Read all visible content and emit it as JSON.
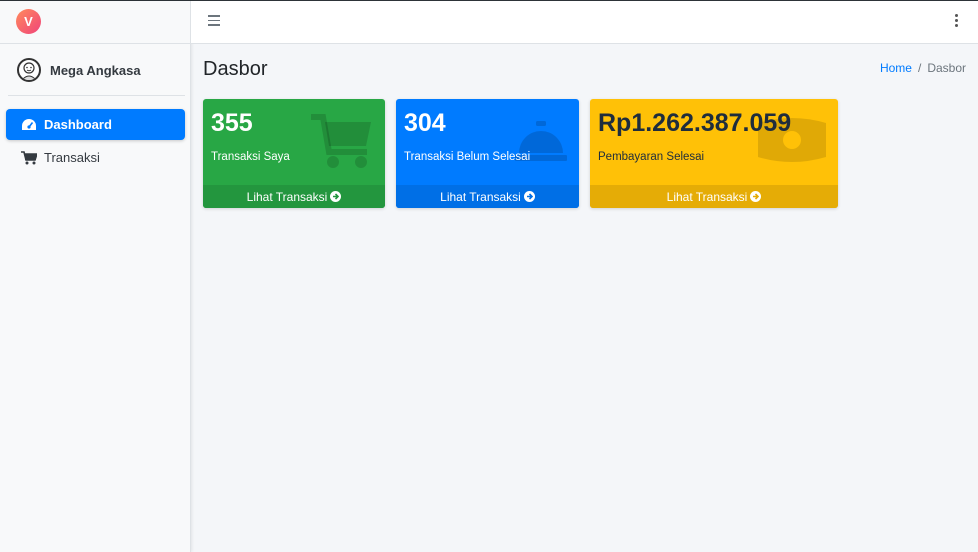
{
  "brand": {
    "logo_letter": "V"
  },
  "user": {
    "name": "Mega Angkasa"
  },
  "sidebar": {
    "items": [
      {
        "label": "Dashboard",
        "icon": "tachometer-icon",
        "active": true
      },
      {
        "label": "Transaksi",
        "icon": "shopping-cart-icon",
        "active": false
      }
    ]
  },
  "navbar": {
    "menu_icon": "hamburger-icon",
    "more_icon": "kebab-icon"
  },
  "page": {
    "title": "Dasbor"
  },
  "breadcrumb": {
    "home": "Home",
    "separator": "/",
    "current": "Dasbor"
  },
  "cards": [
    {
      "value": "355",
      "label": "Transaksi Saya",
      "link": "Lihat Transaksi",
      "icon": "shopping-cart-icon",
      "color": "#28a745"
    },
    {
      "value": "304",
      "label": "Transaksi Belum Selesai",
      "link": "Lihat Transaksi",
      "icon": "concierge-bell-icon",
      "color": "#007bff"
    },
    {
      "value": "Rp1.262.387.059",
      "label": "Pembayaran Selesai",
      "link": "Lihat Transaksi",
      "icon": "money-bill-icon",
      "color": "#ffc107"
    }
  ]
}
